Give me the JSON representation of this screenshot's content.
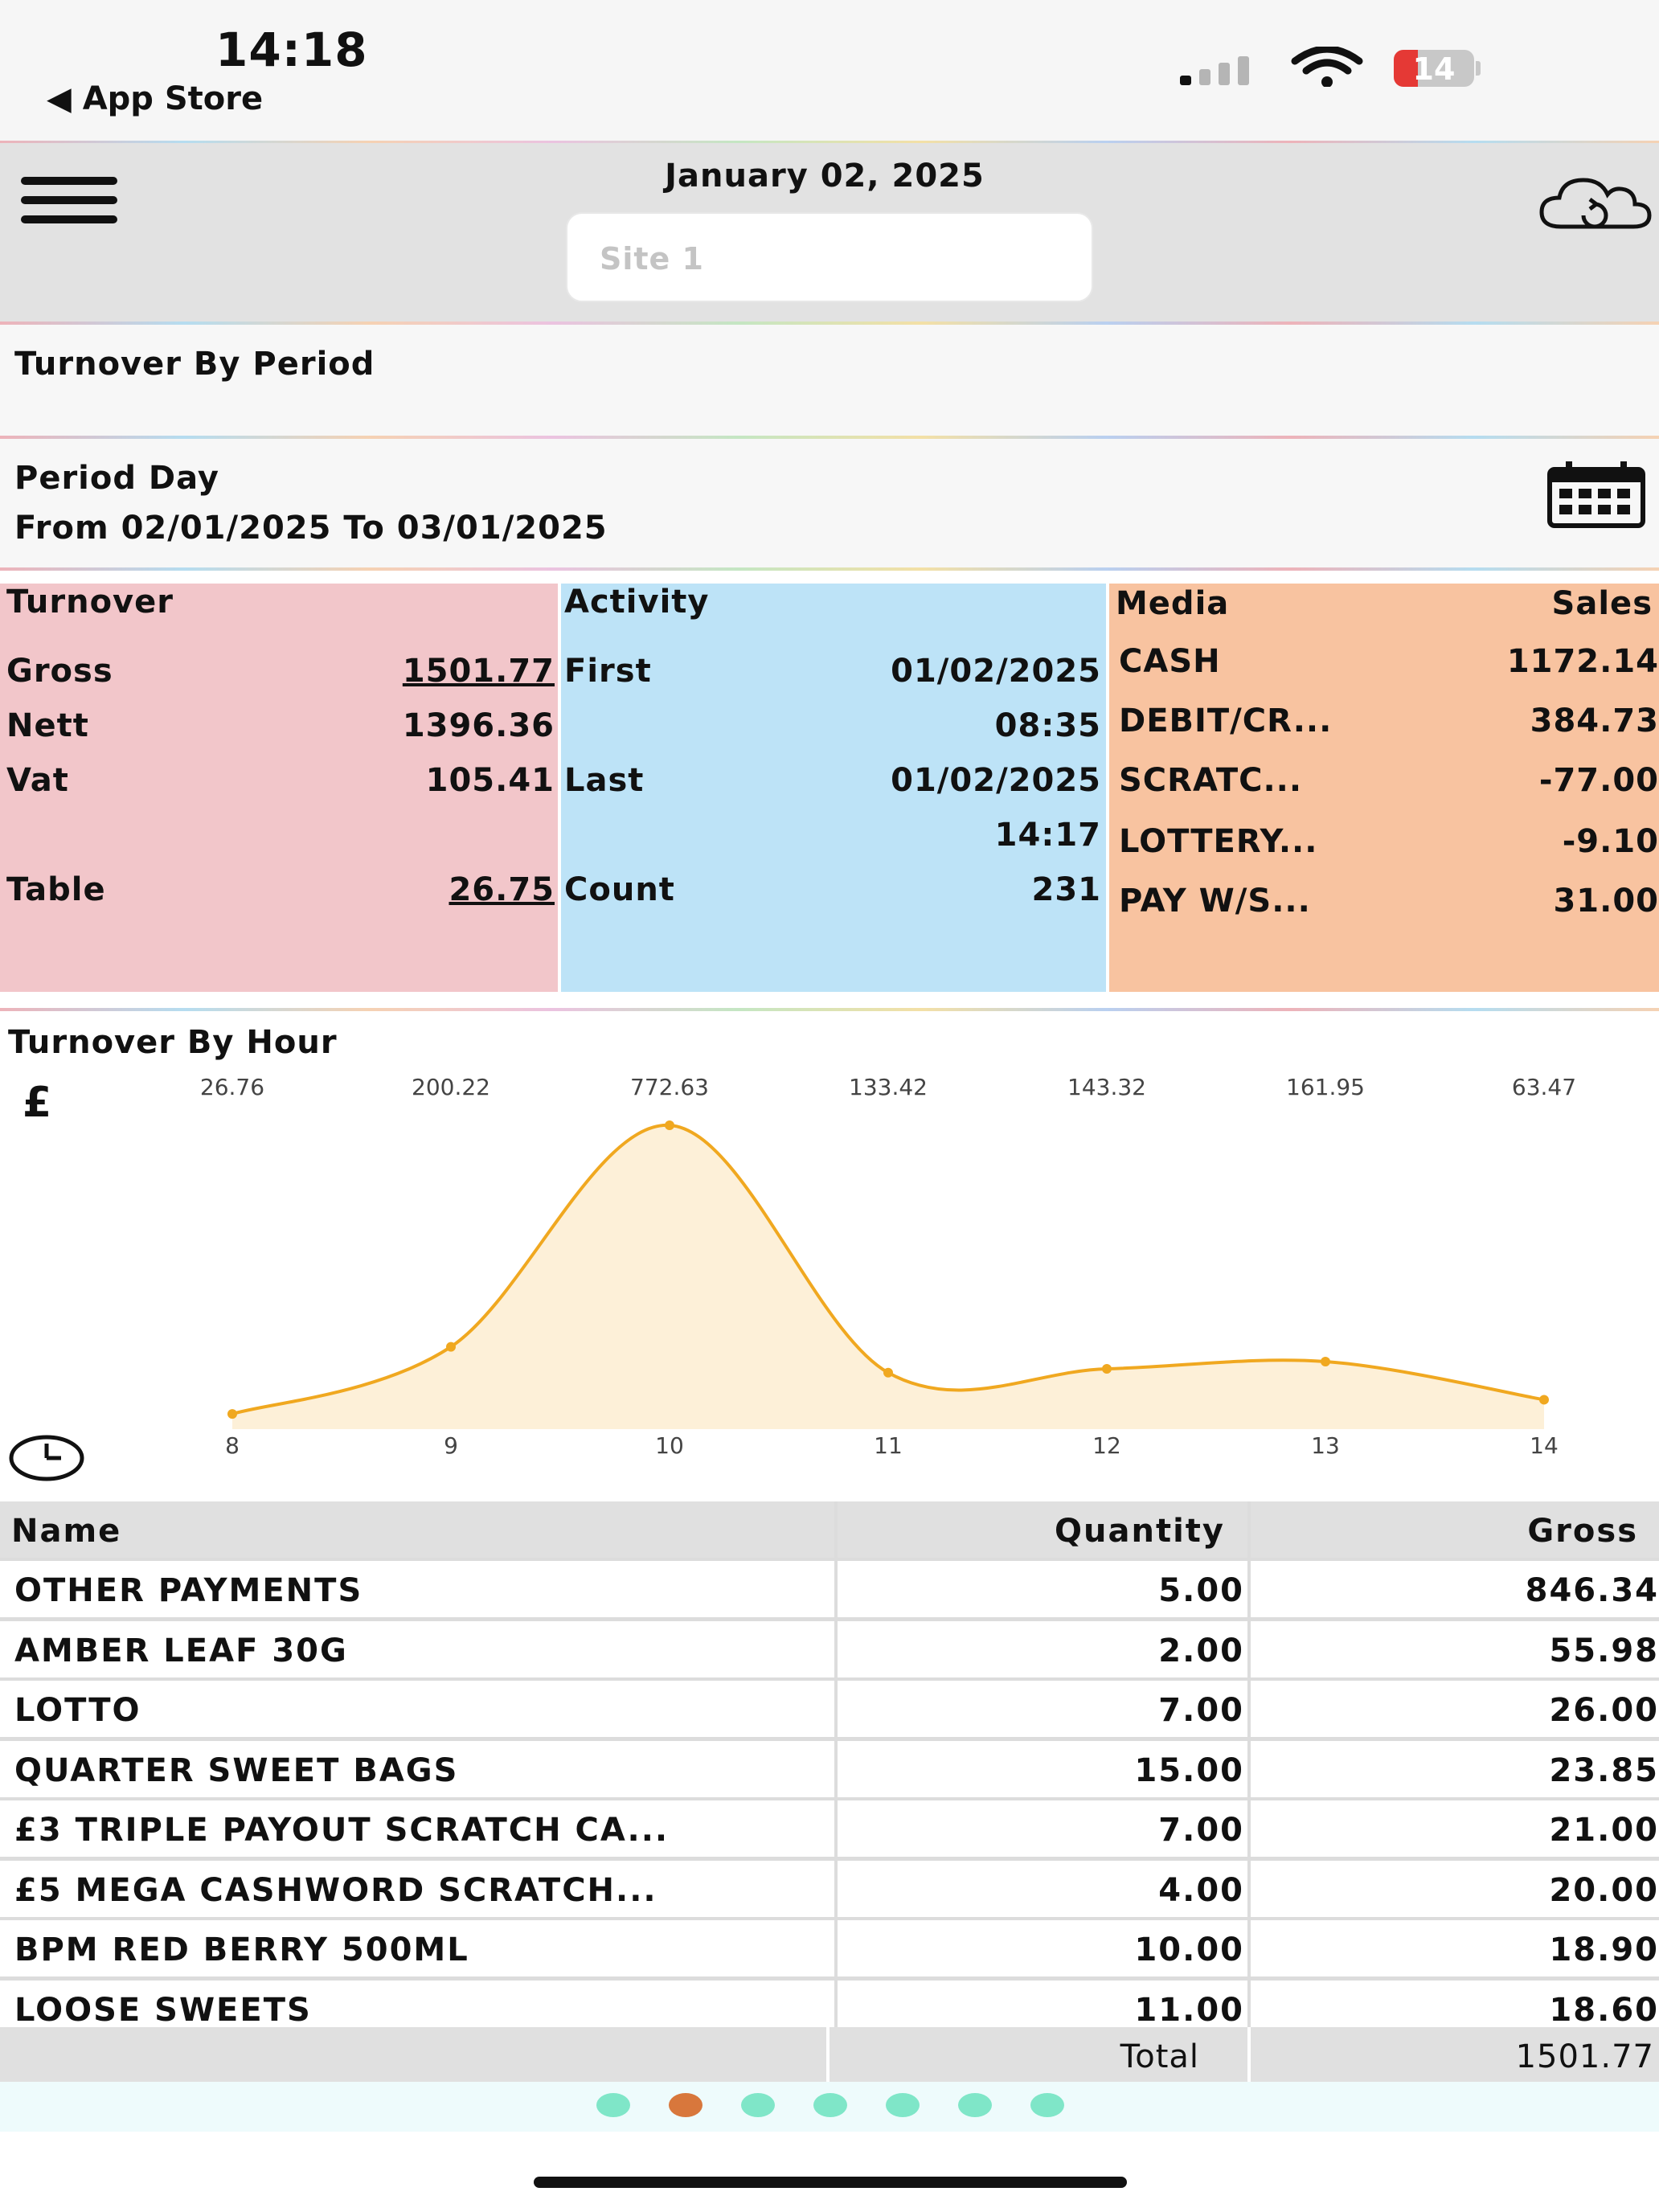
{
  "status_bar": {
    "time": "14:18",
    "back_label": "◀ App Store",
    "battery_level": "14",
    "signal_icon": "cellular-signal-icon",
    "wifi_icon": "wifi-icon"
  },
  "header": {
    "date": "January 02, 2025",
    "site_placeholder": "Site 1",
    "menu_icon": "hamburger-menu-icon",
    "sync_icon": "cloud-sync-icon"
  },
  "turnover_by_period": {
    "title": "Turnover By Period"
  },
  "period": {
    "line1": "Period Day",
    "line2": "From 02/01/2025 To 03/01/2025",
    "calendar_icon": "calendar-icon"
  },
  "turnover_panel": {
    "title": "Turnover",
    "gross_label": "Gross",
    "gross_value": "1501.77",
    "nett_label": "Nett",
    "nett_value": "1396.36",
    "vat_label": "Vat",
    "vat_value": "105.41",
    "table_label": "Table",
    "table_value": "26.75"
  },
  "activity_panel": {
    "title": "Activity",
    "first_label": "First",
    "first_date": "01/02/2025",
    "first_time": "08:35",
    "last_label": "Last",
    "last_date": "01/02/2025",
    "last_time": "14:17",
    "count_label": "Count",
    "count_value": "231"
  },
  "media_panel": {
    "col_media": "Media",
    "col_sales": "Sales",
    "rows": [
      {
        "name": "CASH",
        "value": "1172.14"
      },
      {
        "name": "DEBIT/CR...",
        "value": "384.73"
      },
      {
        "name": "SCRATC...",
        "value": "-77.00"
      },
      {
        "name": "LOTTERY...",
        "value": "-9.10"
      },
      {
        "name": "PAY W/S...",
        "value": "31.00"
      }
    ]
  },
  "turnover_by_hour": {
    "title": "Turnover By Hour",
    "currency_symbol": "£",
    "clock_icon": "clock-icon"
  },
  "chart_data": {
    "type": "area",
    "x": [
      "8",
      "9",
      "10",
      "11",
      "12",
      "13",
      "14"
    ],
    "values": [
      26.76,
      200.22,
      772.63,
      133.42,
      143.32,
      161.95,
      63.47
    ],
    "data_labels": [
      "26.76",
      "200.22",
      "772.63",
      "133.42",
      "143.32",
      "161.95",
      "63.47"
    ],
    "line_color": "#f0a820",
    "fill_color": "#fdf0d8",
    "grid": false
  },
  "items_table": {
    "headers": {
      "name": "Name",
      "quantity": "Quantity",
      "gross": "Gross"
    },
    "rows": [
      {
        "name": "OTHER PAYMENTS",
        "quantity": "5.00",
        "gross": "846.34"
      },
      {
        "name": "AMBER LEAF 30G",
        "quantity": "2.00",
        "gross": "55.98"
      },
      {
        "name": "LOTTO",
        "quantity": "7.00",
        "gross": "26.00"
      },
      {
        "name": "QUARTER SWEET BAGS",
        "quantity": "15.00",
        "gross": "23.85"
      },
      {
        "name": "£3 TRIPLE PAYOUT SCRATCH CA...",
        "quantity": "7.00",
        "gross": "21.00"
      },
      {
        "name": "£5 MEGA CASHWORD SCRATCH...",
        "quantity": "4.00",
        "gross": "20.00"
      },
      {
        "name": "BPM RED BERRY 500ML",
        "quantity": "10.00",
        "gross": "18.90"
      },
      {
        "name": "LOOSE SWEETS",
        "quantity": "11.00",
        "gross": "18.60"
      }
    ],
    "total_label": "Total",
    "total_value": "1501.77"
  },
  "pager": {
    "page_count": 7,
    "active_page": 2
  }
}
